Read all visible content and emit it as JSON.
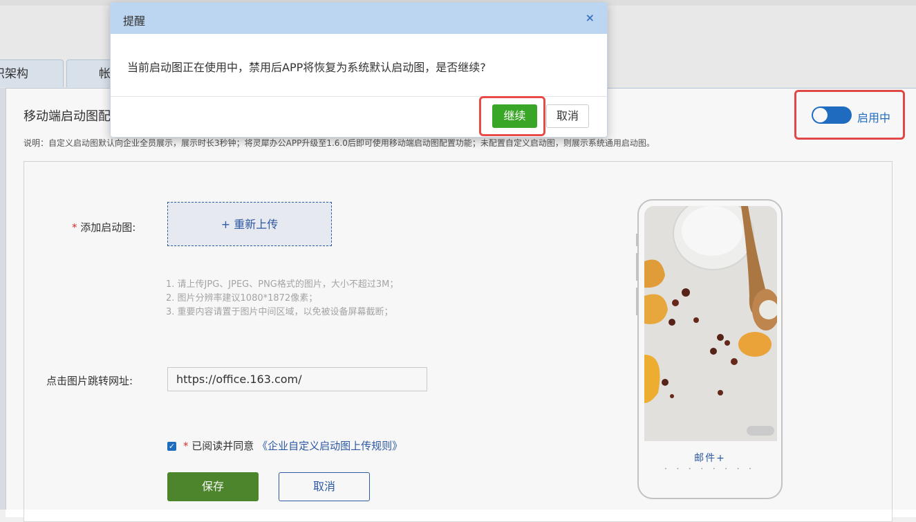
{
  "tabs": [
    {
      "label": "织架构"
    },
    {
      "label": "帐"
    }
  ],
  "section": {
    "title": "移动端启动图配",
    "description": "说明：自定义启动图默认向企业全员展示，展示时长3秒钟；将灵犀办公APP升级至1.6.0后即可使用移动端启动图配置功能；未配置自定义启动图，则展示系统通用启动图。"
  },
  "toggle": {
    "label": "启用中",
    "on": true
  },
  "form": {
    "upload_label": "添加启动图:",
    "required_mark": "*",
    "upload_button": "+ 重新上传",
    "hints": [
      "1. 请上传JPG、JPEG、PNG格式的图片，大小不超过3M；",
      "2. 图片分辨率建议1080*1872像素；",
      "3. 重要内容请置于图片中间区域，以免被设备屏幕截断；"
    ],
    "url_label": "点击图片跳转网址:",
    "url_value": "https://office.163.com/",
    "agree_text": "已阅读并同意",
    "agree_link": "《企业自定义启动图上传规则》",
    "save_button": "保存",
    "cancel_button": "取消"
  },
  "phone_preview": {
    "logo_text": "邮件+"
  },
  "dialog": {
    "title": "提醒",
    "close_icon": "close-icon",
    "message": "当前启动图正在使用中，禁用后APP将恢复为系统默认启动图，是否继续?",
    "confirm_button": "继续",
    "cancel_button": "取消"
  },
  "colors": {
    "accent": "#1f6fc7",
    "highlight": "#e84a4a",
    "confirm": "#3aa627",
    "save": "#4f8a2d"
  }
}
